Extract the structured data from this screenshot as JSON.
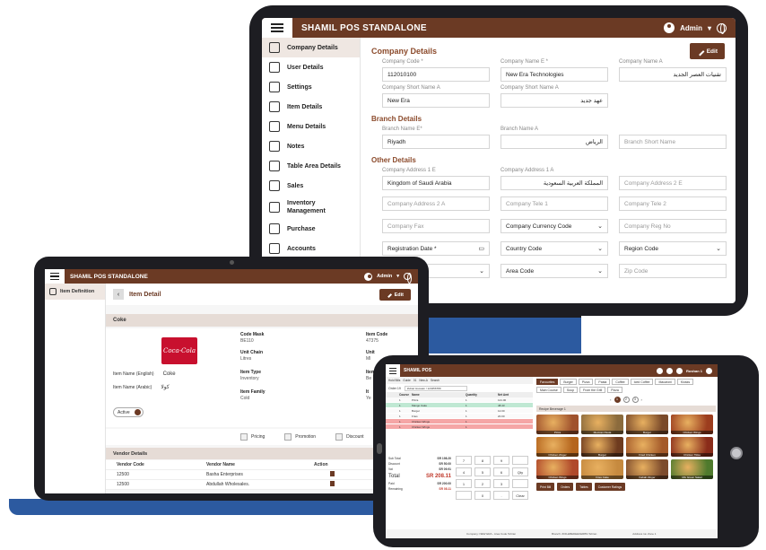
{
  "laptop1": {
    "app_title": "SHAMIL POS STANDALONE",
    "user": "Admin",
    "sidebar": [
      {
        "label": "Company Details",
        "icon": "building-icon",
        "active": true
      },
      {
        "label": "User Details",
        "icon": "user-key-icon"
      },
      {
        "label": "Settings",
        "icon": "gear-icon"
      },
      {
        "label": "Item Details",
        "icon": "list-box-icon"
      },
      {
        "label": "Menu Details",
        "icon": "menu-list-icon"
      },
      {
        "label": "Notes",
        "icon": "note-icon"
      },
      {
        "label": "Table Area Details",
        "icon": "table-area-icon"
      },
      {
        "label": "Sales",
        "icon": "tag-icon"
      },
      {
        "label": "Inventory",
        "label2": "Management",
        "icon": "inventory-icon"
      },
      {
        "label": "Purchase",
        "icon": "cart-icon"
      },
      {
        "label": "Accounts",
        "icon": "accounts-icon"
      }
    ],
    "edit_label": "Edit",
    "company_details_title": "Company Details",
    "branch_details_title": "Branch Details",
    "other_details_title": "Other Details",
    "company": {
      "code_label": "Company Code *",
      "code": "112010100",
      "name_e_label": "Company Name E *",
      "name_e": "New Era Technologies",
      "name_a_label": "Company Name A",
      "name_a": "تقنيات العصر الجديد",
      "short_e_label": "Company Short Name A",
      "short_e": "New Era",
      "short_a_label": "Company Short Name A",
      "short_a": "عهد جديد"
    },
    "branch": {
      "name_e_label": "Branch Name E*",
      "name_e": "Riyadh",
      "name_a_label": "Branch Name A",
      "name_a": "الرياض",
      "short_placeholder": "Branch Short Name"
    },
    "other": {
      "addr1e_label": "Company Address 1 E",
      "addr1e": "Kingdom of Saudi Arabia",
      "addr1a_label": "Company Address 1 A",
      "addr1a": "المملكة العربية السعودية",
      "addr2e_ph": "Company Address 2 E",
      "addr2a_ph": "Company Address 2 A",
      "tel1_ph": "Company Tele 1",
      "tel2_ph": "Company Tele 2",
      "fax_ph": "Company Fax",
      "currency": "Company Currency Code",
      "reg_ph": "Company Reg No",
      "reg_date": "Registration Date *",
      "country": "Country Code",
      "region": "Region Code",
      "area": "Area Code",
      "zip_ph": "Zip Code"
    }
  },
  "laptop2": {
    "app_title": "SHAMIL POS STANDALONE",
    "user": "Admin",
    "sidebar_item": "Item Definition",
    "page_title": "Item Detail",
    "edit_label": "Edit",
    "item_name": "Coke",
    "img_text": "Coca-Cola",
    "fields": [
      {
        "k": "Code Mask",
        "v": "BE110"
      },
      {
        "k": "Item Code",
        "v": "47375"
      },
      {
        "k": "Unit Chain",
        "v": "Litres"
      },
      {
        "k": "Unit",
        "v": "Ml"
      },
      {
        "k": "Item Type",
        "v": "Inventory"
      },
      {
        "k": "Item Class",
        "v": "Be"
      },
      {
        "k": "Item Family",
        "v": "Cold"
      },
      {
        "k": "It",
        "v": "Ye"
      }
    ],
    "name_english_label": "Item Name (English)",
    "name_english": "Coke",
    "name_arabic_label": "Item Name (Arabic)",
    "name_arabic": "كولا",
    "active_label": "Active",
    "checks": [
      "Pricing",
      "Promotion",
      "Discount"
    ],
    "vendor_title": "Vendor Details",
    "vendor_headers": [
      "Vendor Code",
      "Vendor Name",
      "Action"
    ],
    "vendors": [
      {
        "code": "12500",
        "name": "Basha Enterprises"
      },
      {
        "code": "12500",
        "name": "Abdullah Wholesales."
      }
    ]
  },
  "tablet": {
    "app_title": "SHAMIL POS",
    "user": "Roshan 1",
    "toolbar": [
      "Hold Bills",
      "Guide",
      "01",
      "New-A",
      "Search"
    ],
    "order_label": "Order 19",
    "customer": "Zubair Hussain / 123456789",
    "headers": [
      "",
      "Course",
      "Name",
      "Quantity",
      "Net Amt"
    ],
    "lines": [
      {
        "c": "1",
        "n": "Pizza",
        "q": "1",
        "a": "121.00",
        "s": "w"
      },
      {
        "c": "1",
        "n": "Mango Cake",
        "q": "1",
        "a": "48.43",
        "s": "g"
      },
      {
        "c": "1",
        "n": "Burger",
        "q": "1",
        "a": "12.00",
        "s": "w"
      },
      {
        "c": "1",
        "n": "Fries",
        "q": "1",
        "a": "20.00",
        "s": "w"
      },
      {
        "c": "1",
        "n": "Chicken Wings",
        "q": "1",
        "a": "",
        "s": "r"
      },
      {
        "c": "1",
        "n": "Chicken Wings",
        "q": "1",
        "a": "",
        "s": "r"
      }
    ],
    "subtotal_label": "Sub Total",
    "subtotal": "SR 198.20",
    "discount_label": "Discount",
    "discount": "SR 50.00",
    "vat_label": "Vat",
    "vat": "SR 09.91",
    "total_label": "Total",
    "total": "SR 208.11",
    "paid_label": "Paid",
    "paid": "SR 200.00",
    "remaining_label": "Remaining",
    "remaining": "SR 08.11",
    "keys": [
      "7",
      "8",
      "9",
      "",
      "4",
      "5",
      "6",
      "Qty",
      "1",
      "2",
      "3",
      "",
      "",
      "0",
      ".",
      "Clear"
    ],
    "categories": [
      "Favourites",
      "Burger",
      "Pizza",
      "Pasta",
      "Coffee",
      "Iced Coffee",
      "Macaroni",
      "Kiosks",
      "Main Course",
      "Soup",
      "From the Grill",
      "Pizza"
    ],
    "pages": [
      "1",
      "2",
      "3"
    ],
    "recipe_bar": "Recipe Beverage 1",
    "foods": [
      {
        "n": "Pizza",
        "c": "#a0522d"
      },
      {
        "n": "Mexican Pasta",
        "c": "#8b6b3d"
      },
      {
        "n": "Burger",
        "c": "#7a4a2a"
      },
      {
        "n": "Chicken Wings",
        "c": "#9c3d1e"
      },
      {
        "n": "Chicken Zinger",
        "c": "#b5651d"
      },
      {
        "n": "Burger",
        "c": "#6e3b1f"
      },
      {
        "n": "Fried Chicken",
        "c": "#a45a2a"
      },
      {
        "n": "Chicken Tikka",
        "c": "#8a2c1a"
      },
      {
        "n": "Chicken Wings",
        "c": "#b0482a"
      },
      {
        "n": "Fries Cake",
        "c": "#c68a3f"
      },
      {
        "n": "Kabab Zinger",
        "c": "#7d4b2c"
      },
      {
        "n": "Mix Green Salad",
        "c": "#4f7a2d"
      }
    ],
    "actions": [
      "Print Bill",
      "Orders",
      "Tables",
      "Customer Ratings"
    ],
    "footer_left": "Company: NEW ERA - Area Code Tehran",
    "footer_mid": "Branch: ZOILEBEDEEKERBS Tehran",
    "footer_right": "Address 1a: Zone 1"
  }
}
